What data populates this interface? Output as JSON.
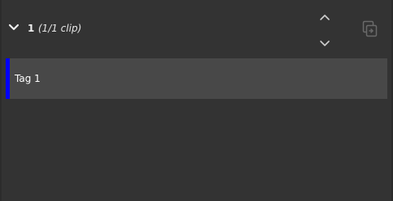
{
  "group": {
    "number": "1",
    "clip_count": "(1/1 clip)"
  },
  "icons": {
    "collapse": "chevron-down-icon",
    "move_up": "chevron-up-icon",
    "move_down": "chevron-down-icon",
    "copy": "copy-icon"
  },
  "tags": [
    {
      "label": "Tag 1",
      "color": "#0000ff"
    }
  ],
  "colors": {
    "background": "#333333",
    "row": "#484848",
    "text": "#ffffff",
    "icon_dim": "#6a6a6a",
    "icon_light": "#d0d0d0"
  }
}
